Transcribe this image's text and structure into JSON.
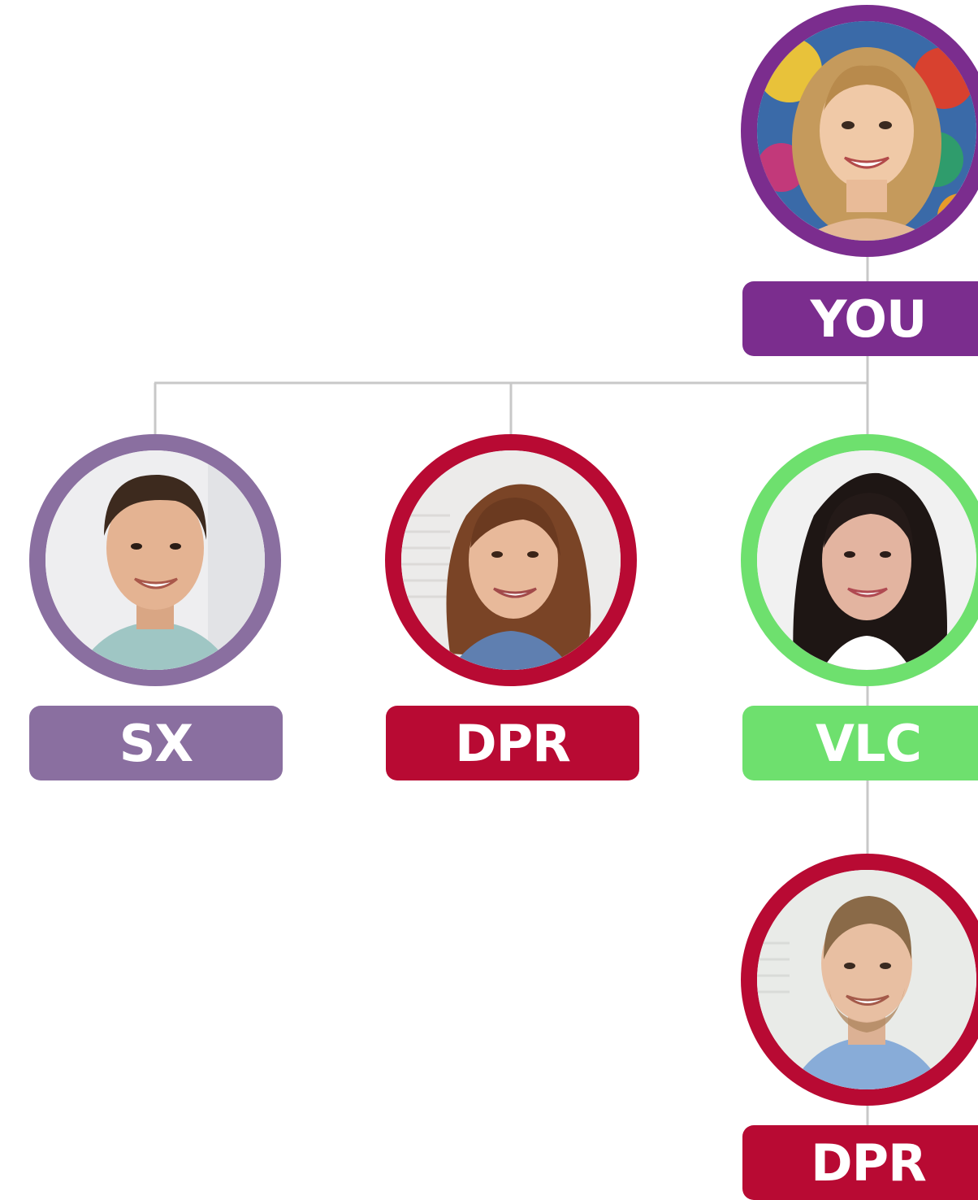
{
  "nodes": {
    "you": {
      "label": "YOU",
      "color": "#7b2d8e",
      "photo": "woman-curly-blonde-hair-colorful-background"
    },
    "sx": {
      "label": "SX",
      "color": "#8a6fa0",
      "photo": "man-short-brown-hair-mint-shirt"
    },
    "dpr1": {
      "label": "DPR",
      "color": "#b80a33",
      "photo": "woman-shoulder-length-brown-hair"
    },
    "vlc": {
      "label": "VLC",
      "color": "#6ee06e",
      "photo": "woman-long-dark-hair"
    },
    "dpr2": {
      "label": "DPR",
      "color": "#b80a33",
      "photo": "man-beard-blue-tshirt"
    }
  },
  "connector_color": "#c8c8c8"
}
